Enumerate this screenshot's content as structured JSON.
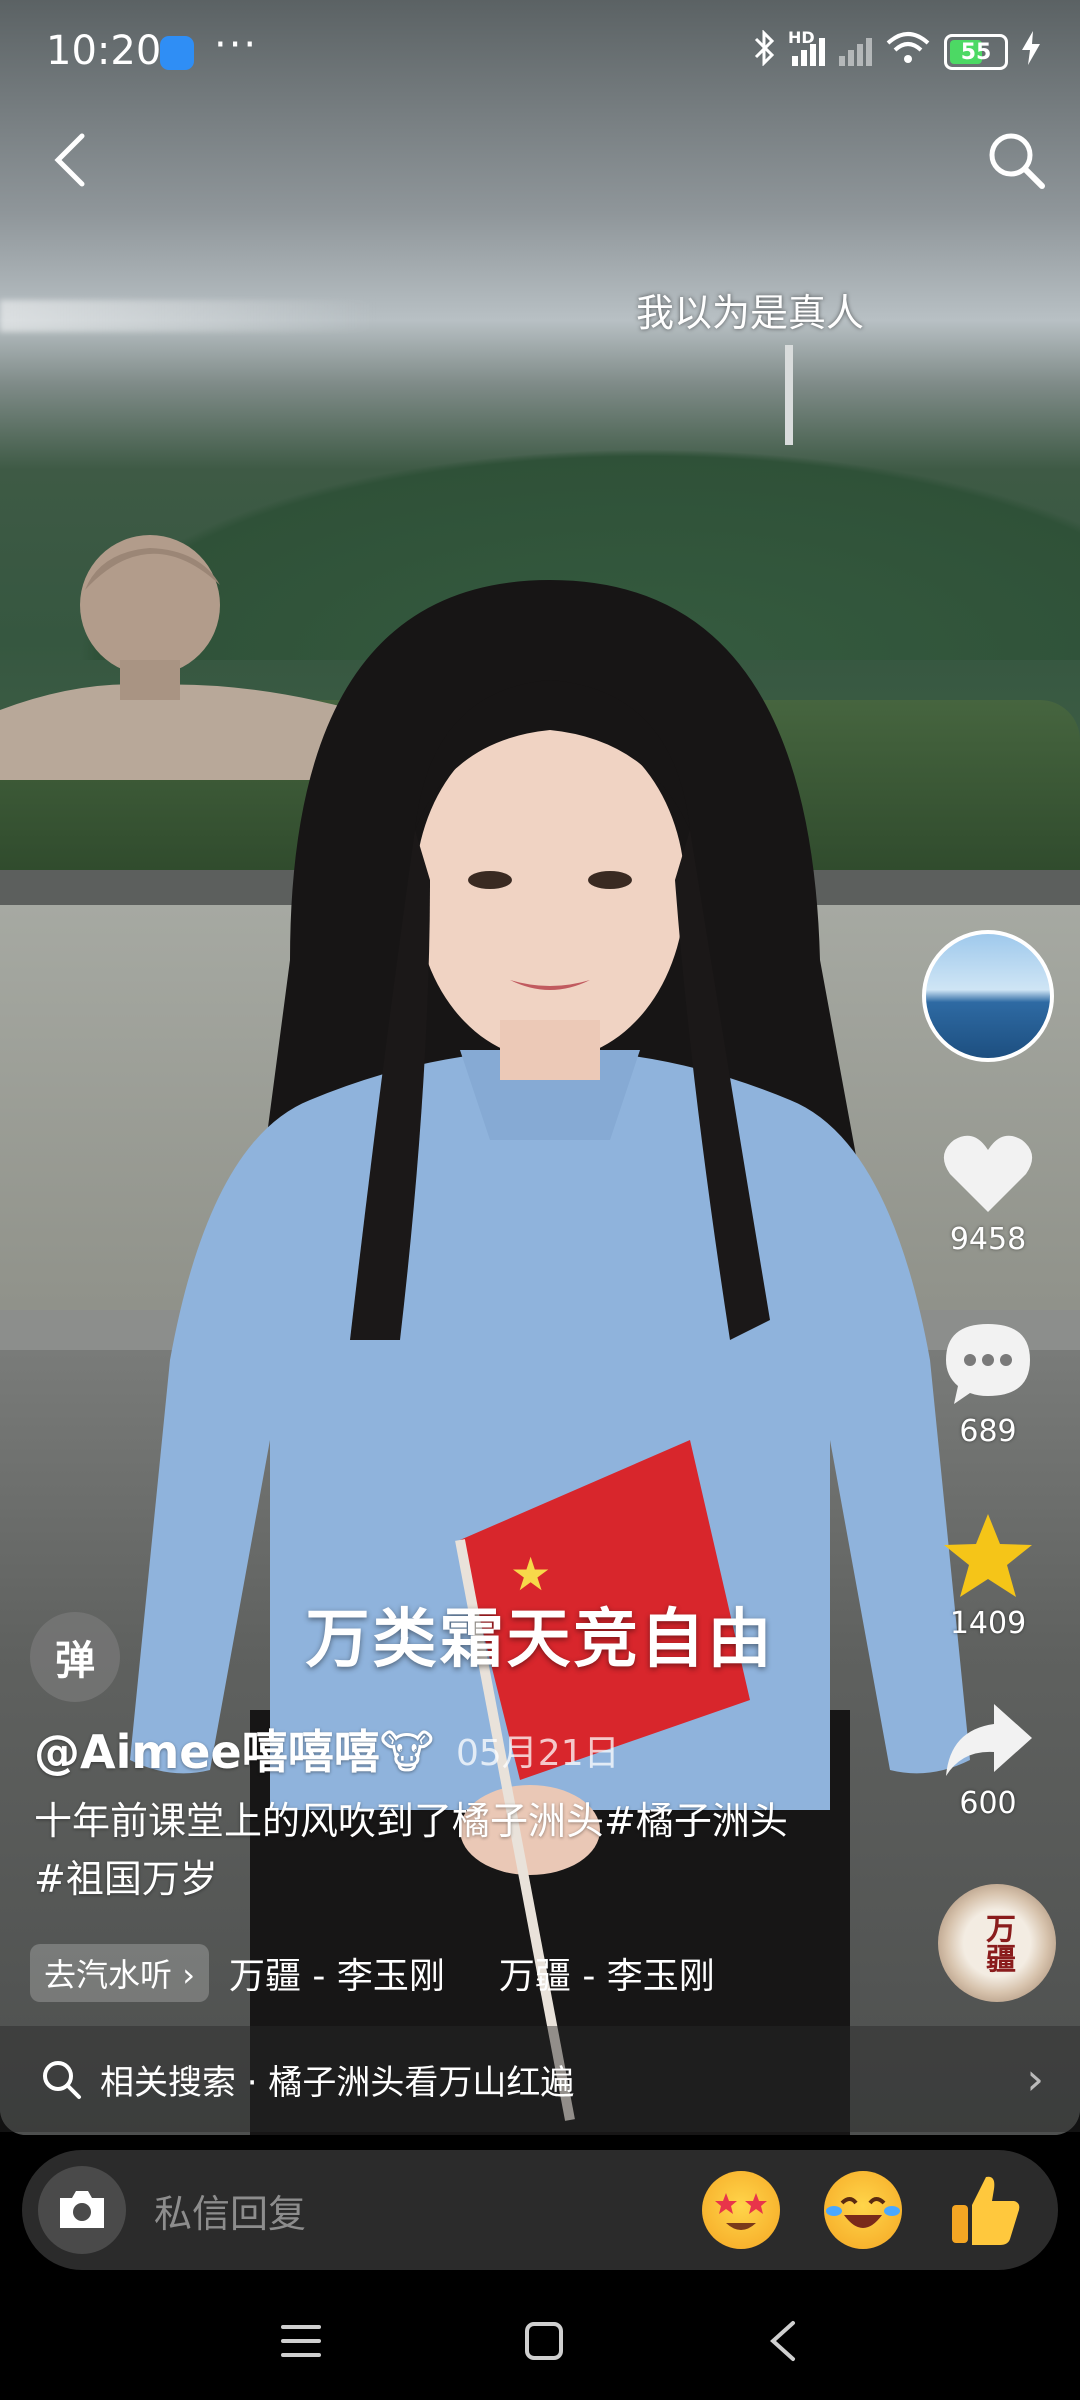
{
  "status_bar": {
    "time": "10:20",
    "more": "···",
    "network_label": "HD",
    "battery": "55"
  },
  "overlay": {
    "danmaku": "我以为是真人",
    "subtitle": "万类霜天竞自由",
    "danmu_toggle": "弹"
  },
  "side_actions": {
    "like_count": "9458",
    "comment_count": "689",
    "favorite_count": "1409",
    "share_count": "600",
    "music_disc_text": "万疆"
  },
  "post": {
    "author": "@Aimee嘻嘻嘻🐮",
    "date": "05月21日",
    "description": "十年前课堂上的风吹到了橘子洲头#橘子洲头#祖国万岁",
    "music_tag": "去汽水听",
    "music_tag_arrow": "›",
    "music_1": "万疆 - 李玉刚",
    "music_2": "万疆 - 李玉刚"
  },
  "related_search": {
    "label": "相关搜索 · 橘子洲头看万山红遍",
    "arrow": "›"
  },
  "reply": {
    "placeholder": "私信回复",
    "emojis": [
      "star-eyes-emoji",
      "laughing-tears-emoji",
      "thumbs-up-emoji"
    ]
  },
  "colors": {
    "accent_star": "#f5c518",
    "battery_green": "#4cd964"
  }
}
